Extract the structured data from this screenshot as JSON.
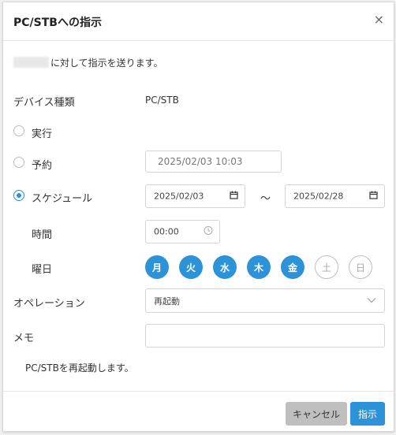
{
  "dialog": {
    "title": "PC/STBへの指示"
  },
  "intro_text": "に対して指示を送ります。",
  "device_type": {
    "label": "デバイス種類",
    "value": "PC/STB"
  },
  "options": {
    "run": "実行",
    "reserve": "予約",
    "reserve_datetime": "2025/02/03 10:03",
    "schedule": "スケジュール",
    "start_date": "2025/02/03",
    "tilde": "～",
    "end_date": "2025/02/28"
  },
  "time": {
    "label": "時間",
    "value": "00:00"
  },
  "weekday": {
    "label": "曜日",
    "days": [
      "月",
      "火",
      "水",
      "木",
      "金",
      "土",
      "日"
    ],
    "selected": [
      true,
      true,
      true,
      true,
      true,
      false,
      false
    ]
  },
  "operation": {
    "label": "オペレーション",
    "value": "再起動"
  },
  "memo": {
    "label": "メモ",
    "value": ""
  },
  "description": "PC/STBを再起動します。",
  "buttons": {
    "cancel": "キャンセル",
    "submit": "指示"
  }
}
